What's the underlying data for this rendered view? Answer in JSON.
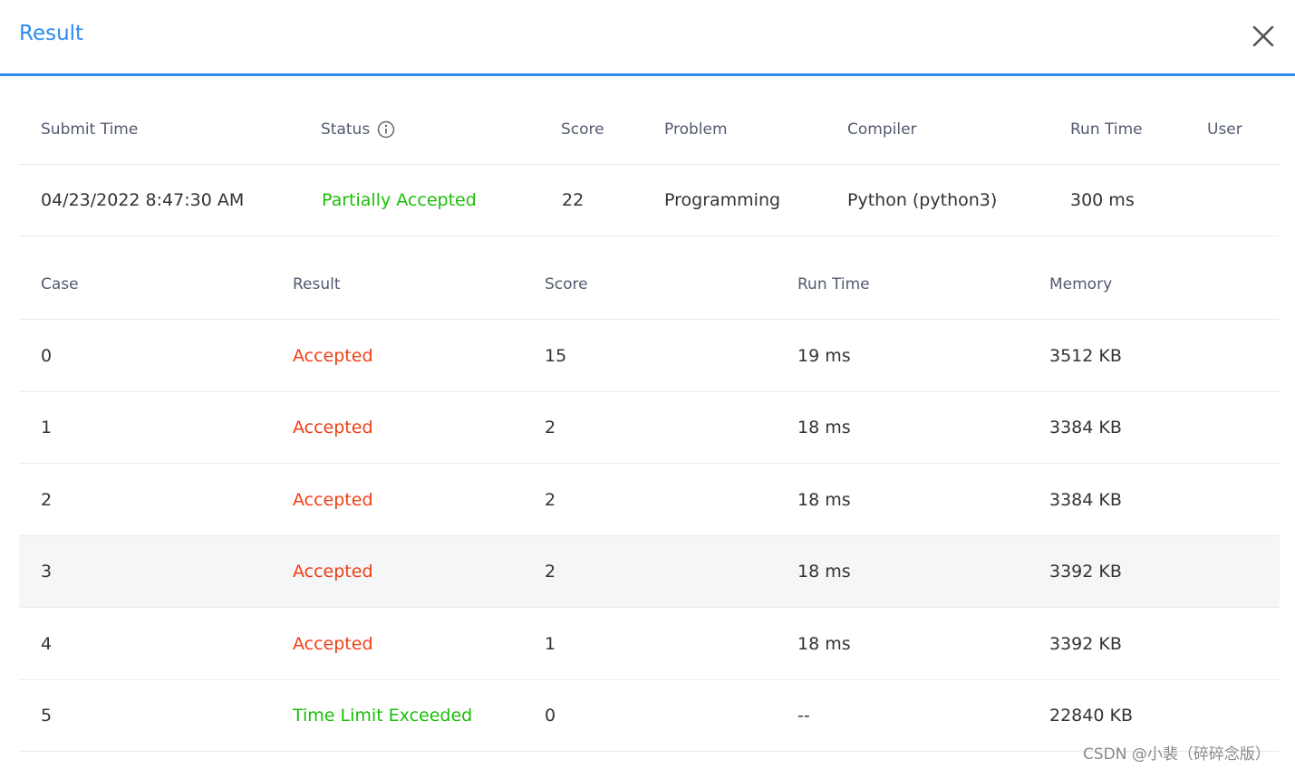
{
  "dialog": {
    "title": "Result",
    "close_icon": "close-icon"
  },
  "submission": {
    "headers": {
      "submit_time": "Submit Time",
      "status": "Status",
      "score": "Score",
      "problem": "Problem",
      "compiler": "Compiler",
      "run_time": "Run Time",
      "user": "User"
    },
    "row": {
      "submit_time": "04/23/2022 8:47:30 AM",
      "status": "Partially Accepted",
      "score": "22",
      "problem": "Programming",
      "compiler": "Python (python3)",
      "run_time": "300 ms",
      "user": ""
    }
  },
  "cases": {
    "headers": {
      "case": "Case",
      "result": "Result",
      "score": "Score",
      "run_time": "Run Time",
      "memory": "Memory"
    },
    "rows": [
      {
        "case": "0",
        "result": "Accepted",
        "score": "15",
        "run_time": "19 ms",
        "memory": "3512 KB"
      },
      {
        "case": "1",
        "result": "Accepted",
        "score": "2",
        "run_time": "18 ms",
        "memory": "3384 KB"
      },
      {
        "case": "2",
        "result": "Accepted",
        "score": "2",
        "run_time": "18 ms",
        "memory": "3384 KB"
      },
      {
        "case": "3",
        "result": "Accepted",
        "score": "2",
        "run_time": "18 ms",
        "memory": "3392 KB"
      },
      {
        "case": "4",
        "result": "Accepted",
        "score": "1",
        "run_time": "18 ms",
        "memory": "3392 KB"
      },
      {
        "case": "5",
        "result": "Time Limit Exceeded",
        "score": "0",
        "run_time": "--",
        "memory": "22840 KB"
      }
    ]
  },
  "colors": {
    "accent": "#2d8cf0",
    "accepted": "#ed3f14",
    "status_green": "#19be06"
  },
  "watermark": "CSDN @小裴（碎碎念版）"
}
